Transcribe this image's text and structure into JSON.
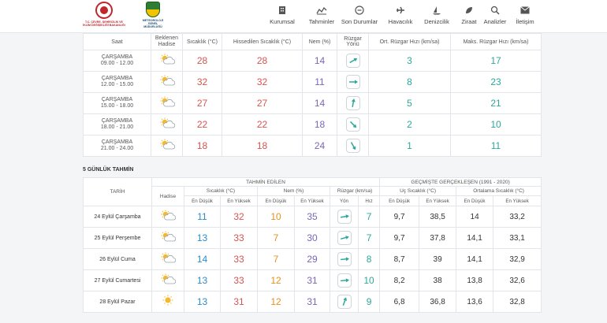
{
  "header": {
    "logo1_caption": "T.C. ÇEVRE, ŞEHİRCİLİK VE İKLİM DEĞİŞİKLİĞİ BAKANLIĞI",
    "logo2_caption": "METEOROLOJİ GENEL MÜDÜRLÜĞÜ",
    "nav": [
      {
        "label": "Kurumsal",
        "icon": "building-icon"
      },
      {
        "label": "Tahminler",
        "icon": "chart-icon"
      },
      {
        "label": "Son Durumlar",
        "icon": "gauge-icon"
      },
      {
        "label": "Havacılık",
        "icon": "plane-icon"
      },
      {
        "label": "Denizcilik",
        "icon": "sail-icon"
      },
      {
        "label": "Ziraat",
        "icon": "leaf-icon"
      },
      {
        "label": "Analizler",
        "icon": "analysis-icon"
      },
      {
        "label": "İletişim",
        "icon": "mail-icon"
      }
    ]
  },
  "hourly": {
    "headers": {
      "saat": "Saat",
      "hadise": "Beklenen Hadise",
      "sicaklik": "Sıcaklık (°C)",
      "hissedilen": "Hissedilen Sıcaklık (°C)",
      "nem": "Nem (%)",
      "ruzgar_yonu": "Rüzgar Yönü",
      "ort_ruzgar": "Ort. Rüzgar Hızı (km/sa)",
      "maks_ruzgar": "Maks. Rüzgar Hızı (km/sa)"
    },
    "rows": [
      {
        "day": "ÇARŞAMBA",
        "time": "09.00 - 12.00",
        "temp": "28",
        "feels": "28",
        "hum": "14",
        "dir_deg": 60,
        "avg": "3",
        "max": "17"
      },
      {
        "day": "ÇARŞAMBA",
        "time": "12.00 - 15.00",
        "temp": "32",
        "feels": "32",
        "hum": "11",
        "dir_deg": 90,
        "avg": "8",
        "max": "23"
      },
      {
        "day": "ÇARŞAMBA",
        "time": "15.00 - 18.00",
        "temp": "27",
        "feels": "27",
        "hum": "14",
        "dir_deg": 10,
        "avg": "5",
        "max": "21"
      },
      {
        "day": "ÇARŞAMBA",
        "time": "18.00 - 21.00",
        "temp": "22",
        "feels": "22",
        "hum": "18",
        "dir_deg": 135,
        "avg": "2",
        "max": "10"
      },
      {
        "day": "ÇARŞAMBA",
        "time": "21.00 - 24.00",
        "temp": "18",
        "feels": "18",
        "hum": "24",
        "dir_deg": 150,
        "avg": "1",
        "max": "11"
      }
    ]
  },
  "forecast": {
    "title": "5 GÜNLÜK TAHMİN",
    "headers": {
      "tahmin_edilen": "TAHMİN EDİLEN",
      "gecmiste": "GEÇMİŞTE GERÇEKLEŞEN (1991 - 2020)",
      "tarih": "TARİH",
      "hadise": "Hadise",
      "sicaklik": "Sıcaklık (°C)",
      "nem": "Nem (%)",
      "ruzgar": "Rüzgar (km/sa)",
      "uc_sicaklik": "Uç Sıcaklık (°C)",
      "ort_sicaklik": "Ortalama Sıcaklık (°C)",
      "en_dusuk": "En Düşük",
      "en_yuksek": "En Yüksek",
      "yon": "Yön",
      "hiz": "Hız"
    },
    "rows": [
      {
        "date": "24 Eylül Çarşamba",
        "icon": "partly-cloudy-icon",
        "tmin": "11",
        "tmax": "32",
        "hmin": "10",
        "hmax": "35",
        "dir_deg": 80,
        "speed": "7",
        "ext_min": "9,7",
        "ext_max": "38,5",
        "avg_min": "14",
        "avg_max": "33,2"
      },
      {
        "date": "25 Eylül Perşembe",
        "icon": "partly-cloudy-icon",
        "tmin": "13",
        "tmax": "33",
        "hmin": "7",
        "hmax": "30",
        "dir_deg": 75,
        "speed": "7",
        "ext_min": "9,7",
        "ext_max": "37,8",
        "avg_min": "14,1",
        "avg_max": "33,1"
      },
      {
        "date": "26 Eylül Cuma",
        "icon": "partly-cloudy-icon",
        "tmin": "14",
        "tmax": "33",
        "hmin": "7",
        "hmax": "29",
        "dir_deg": 85,
        "speed": "8",
        "ext_min": "8,7",
        "ext_max": "39",
        "avg_min": "14,1",
        "avg_max": "32,9"
      },
      {
        "date": "27 Eylül Cumartesi",
        "icon": "partly-cloudy-icon",
        "tmin": "13",
        "tmax": "33",
        "hmin": "12",
        "hmax": "31",
        "dir_deg": 85,
        "speed": "10",
        "ext_min": "8,2",
        "ext_max": "38",
        "avg_min": "13,8",
        "avg_max": "32,6"
      },
      {
        "date": "28 Eylül Pazar",
        "icon": "sunny-icon",
        "tmin": "13",
        "tmax": "31",
        "hmin": "12",
        "hmax": "31",
        "dir_deg": 20,
        "speed": "9",
        "ext_min": "6,8",
        "ext_max": "36,8",
        "avg_min": "13,6",
        "avg_max": "32,8"
      }
    ]
  },
  "colors": {
    "temp": "#d9534f",
    "humidity": "#7a67b8",
    "wind": "#2ba89b",
    "low": "#2a8bd0",
    "humidity_low": "#e6901a"
  }
}
